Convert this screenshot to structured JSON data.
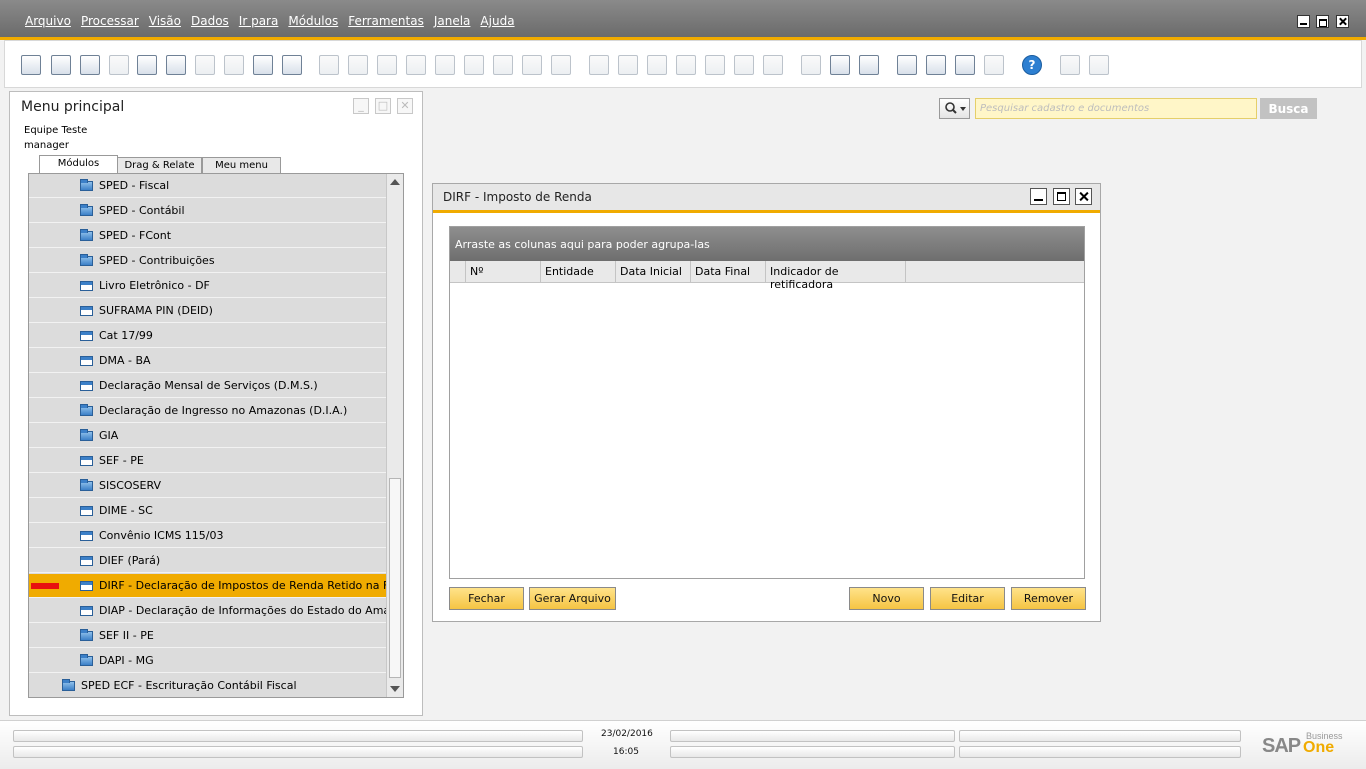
{
  "menubar": {
    "items": [
      "Arquivo",
      "Processar",
      "Visão",
      "Dados",
      "Ir para",
      "Módulos",
      "Ferramentas",
      "Janela",
      "Ajuda"
    ]
  },
  "main_menu": {
    "title": "Menu principal",
    "company": "Equipe Teste",
    "user": "manager",
    "tabs": [
      "Módulos",
      "Drag & Relate",
      "Meu menu"
    ],
    "items": [
      {
        "label": "SPED - Fiscal",
        "icon": "folder-icon"
      },
      {
        "label": "SPED - Contábil",
        "icon": "folder-icon"
      },
      {
        "label": "SPED - FCont",
        "icon": "folder-icon"
      },
      {
        "label": "SPED - Contribuições",
        "icon": "folder-icon"
      },
      {
        "label": "Livro Eletrônico - DF",
        "icon": "form-icon"
      },
      {
        "label": "SUFRAMA PIN (DEID)",
        "icon": "form-icon"
      },
      {
        "label": "Cat 17/99",
        "icon": "form-icon"
      },
      {
        "label": "DMA - BA",
        "icon": "form-icon"
      },
      {
        "label": "Declaração Mensal de Serviços (D.M.S.)",
        "icon": "form-icon"
      },
      {
        "label": "Declaração de Ingresso no Amazonas (D.I.A.)",
        "icon": "folder-icon"
      },
      {
        "label": "GIA",
        "icon": "folder-icon"
      },
      {
        "label": "SEF - PE",
        "icon": "form-icon"
      },
      {
        "label": "SISCOSERV",
        "icon": "folder-icon"
      },
      {
        "label": "DIME - SC",
        "icon": "form-icon"
      },
      {
        "label": "Convênio ICMS 115/03",
        "icon": "form-icon"
      },
      {
        "label": "DIEF (Pará)",
        "icon": "form-icon"
      },
      {
        "label": "DIRF - Declaração de Impostos de Renda Retido na Fonte",
        "icon": "form-icon",
        "selected": true
      },
      {
        "label": "DIAP - Declaração de Informações do Estado do Amapá",
        "icon": "form-icon"
      },
      {
        "label": "SEF II - PE",
        "icon": "folder-icon"
      },
      {
        "label": "DAPI - MG",
        "icon": "folder-icon"
      },
      {
        "label": "SPED ECF - Escrituração Contábil Fiscal",
        "icon": "folder-icon"
      }
    ]
  },
  "search": {
    "placeholder": "Pesquisar cadastro e documentos",
    "button": "Busca"
  },
  "dirf_window": {
    "title": "DIRF - Imposto de Renda",
    "group_hint": "Arraste as colunas aqui para poder agrupa-las",
    "columns": [
      "Nº",
      "Entidade",
      "Data Inicial",
      "Data Final",
      "Indicador de retificadora"
    ],
    "buttons": {
      "close": "Fechar",
      "generate": "Gerar Arquivo",
      "new": "Novo",
      "edit": "Editar",
      "remove": "Remover"
    }
  },
  "status": {
    "date": "23/02/2016",
    "time": "16:05",
    "logo_sap": "SAP",
    "logo_business": "Business",
    "logo_one": "One"
  },
  "colors": {
    "accent": "#f0ab00",
    "button": "#f5c443",
    "menubar": "#7a7a7a"
  }
}
